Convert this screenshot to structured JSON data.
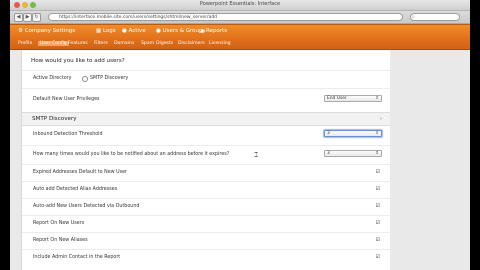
{
  "window": {
    "title": "Powerpoint Essentials: Interface"
  },
  "browser": {
    "url": "https://interface.mobile.site.com/users/settings/shtml/new_server/add",
    "url_icon": "globe-icon",
    "search_icon": "magnifier-icon"
  },
  "nav": {
    "items": [
      {
        "label": "Company Settings",
        "icon": "gear-icon"
      },
      {
        "label": "Logs",
        "icon": "list-icon"
      },
      {
        "label": "Active",
        "icon": "activity-icon"
      },
      {
        "label": "Users & Groups",
        "icon": "users-icon"
      },
      {
        "label": "Reports",
        "icon": "chart-icon"
      }
    ]
  },
  "subnav": {
    "items": [
      {
        "label": "Profile"
      },
      {
        "label": "User Config"
      },
      {
        "label": "Features"
      },
      {
        "label": "Filters"
      },
      {
        "label": "Domains"
      },
      {
        "label": "Spam"
      },
      {
        "label": "Digests"
      },
      {
        "label": "Disclaimers"
      },
      {
        "label": "Licensing"
      }
    ],
    "active_index": 1
  },
  "form": {
    "question": "How would you like to add users?",
    "opt_active_directory": "Active Directory",
    "opt_smtp_discovery": "SMTP Discovery",
    "default_priv_label": "Default New User Privileges",
    "default_priv_value": "End User",
    "section_title": "SMTP Discovery",
    "inbound_label": "Inbound Detection Threshold",
    "inbound_value": "3",
    "notify_label": "How many times would you like to be notified about an address before it expires?",
    "notify_value": "3",
    "checks": [
      "Expired Addresses Default to New User",
      "Auto add Detected Alias Addresses",
      "Auto-add New Users Detected via Outbound",
      "Report On New Users",
      "Report On New Aliases",
      "Include Admin Contact in the Report"
    ]
  }
}
